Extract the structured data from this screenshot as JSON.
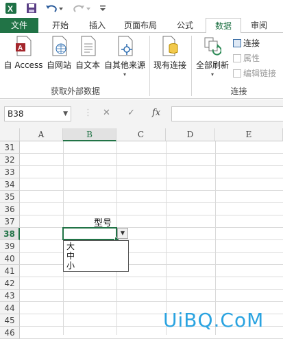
{
  "tabs": [
    "文件",
    "开始",
    "插入",
    "页面布局",
    "公式",
    "数据",
    "审阅"
  ],
  "ribbon": {
    "get_external": {
      "buttons": [
        "自 Access",
        "自网站",
        "自文本",
        "自其他来源"
      ],
      "group_label": "获取外部数据"
    },
    "existing_conn": "现有连接",
    "connections": {
      "refresh_all": "全部刷新",
      "items": [
        "连接",
        "属性",
        "编辑链接"
      ],
      "group_label": "连接"
    }
  },
  "formula_bar": {
    "name_box": "B38",
    "cancel_icon": "✕",
    "enter_icon": "✓",
    "fx_icon": "fx",
    "value": ""
  },
  "sheet": {
    "columns": [
      "A",
      "B",
      "C",
      "D",
      "E"
    ],
    "rows": [
      "31",
      "32",
      "33",
      "34",
      "35",
      "36",
      "37",
      "38",
      "39",
      "40",
      "41",
      "42",
      "43",
      "44",
      "45",
      "46"
    ],
    "selected_column": "B",
    "selected_row": "38",
    "cells": {
      "C37": "型号"
    },
    "dropdown_options": [
      "大",
      "中",
      "小"
    ]
  },
  "watermark": "UiBQ.CoM",
  "colors": {
    "accent": "#217346",
    "watermark": "#2aa3e0"
  }
}
